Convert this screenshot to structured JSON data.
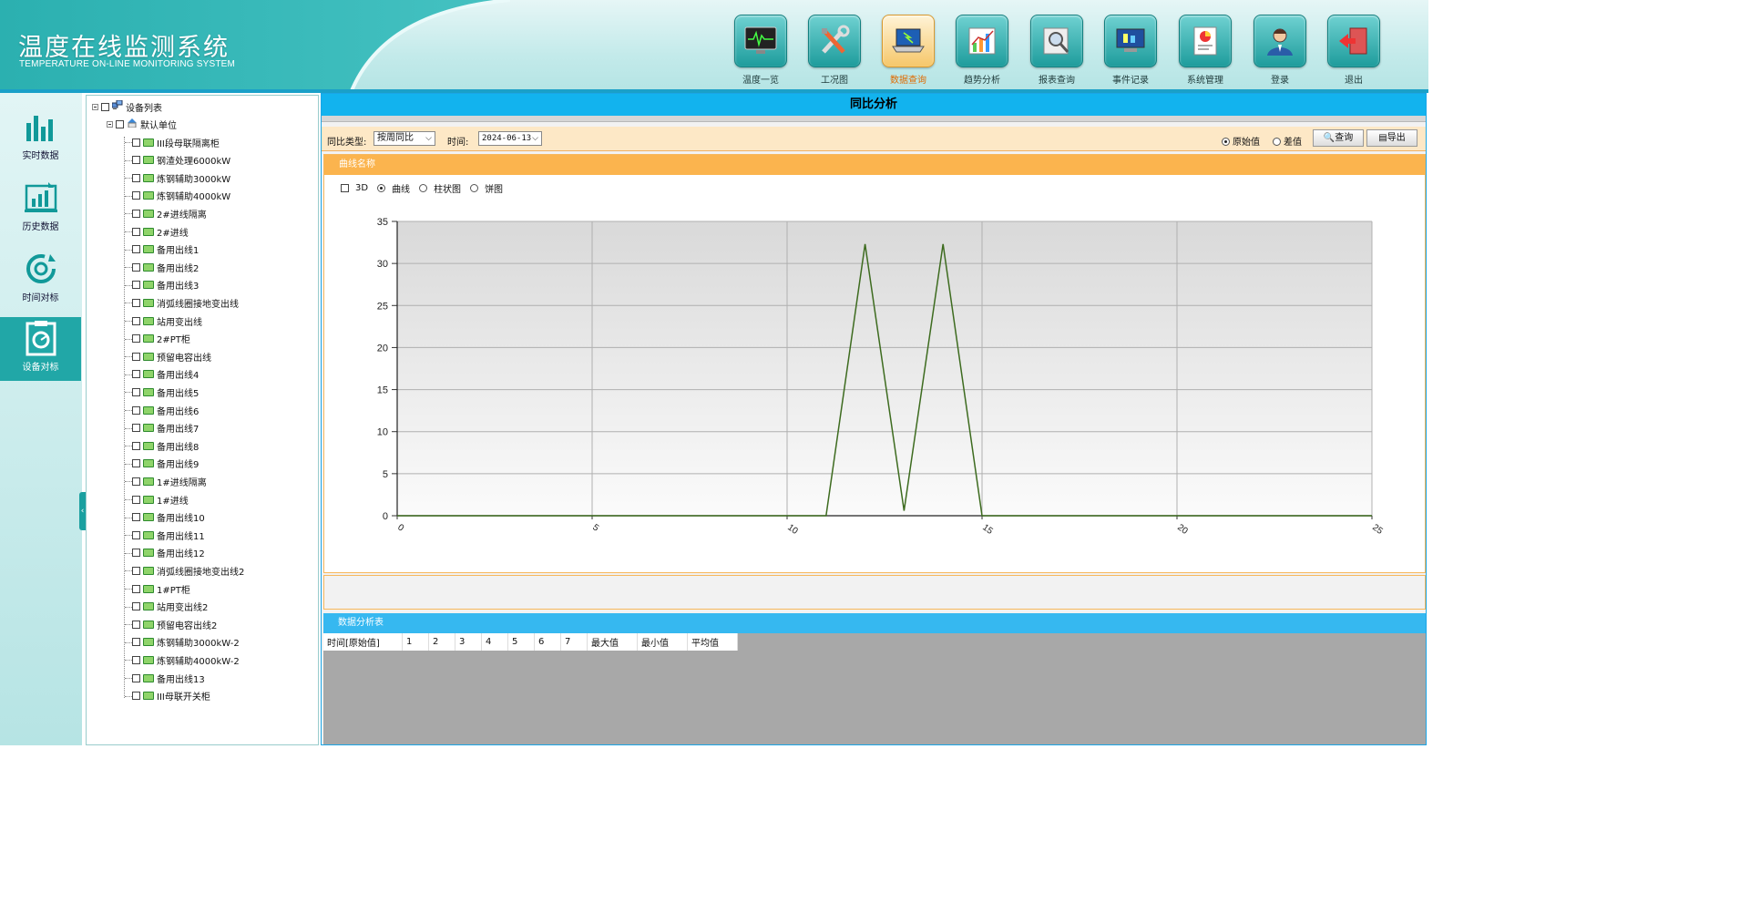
{
  "app": {
    "title": "温度在线监测系统",
    "subtitle": "TEMPERATURE ON-LINE MONITORING SYSTEM"
  },
  "nav": [
    {
      "label": "温度一览",
      "icon": "monitor-waveform-icon",
      "active": false
    },
    {
      "label": "工况图",
      "icon": "tools-icon",
      "active": false
    },
    {
      "label": "数据查询",
      "icon": "laptop-icon",
      "active": true
    },
    {
      "label": "趋势分析",
      "icon": "trend-chart-icon",
      "active": false
    },
    {
      "label": "报表查询",
      "icon": "magnifier-icon",
      "active": false
    },
    {
      "label": "事件记录",
      "icon": "event-screen-icon",
      "active": false
    },
    {
      "label": "系统管理",
      "icon": "document-chart-icon",
      "active": false
    },
    {
      "label": "登录",
      "icon": "user-icon",
      "active": false
    },
    {
      "label": "退出",
      "icon": "exit-door-icon",
      "active": false
    }
  ],
  "sidebar": [
    {
      "label": "实时数据",
      "icon": "bar-chart-icon",
      "active": false
    },
    {
      "label": "历史数据",
      "icon": "history-chart-icon",
      "active": false
    },
    {
      "label": "时间对标",
      "icon": "refresh-cycle-icon",
      "active": false
    },
    {
      "label": "设备对标",
      "icon": "clipboard-gauge-icon",
      "active": true
    }
  ],
  "tree": {
    "root": "设备列表",
    "unit": "默认单位",
    "items": [
      "III段母联隔离柜",
      "钢渣处理6000kW",
      "炼钢辅助3000kW",
      "炼钢辅助4000kW",
      "2#进线隔离",
      "2#进线",
      "备用出线1",
      "备用出线2",
      "备用出线3",
      "消弧线圈接地变出线",
      "站用变出线",
      "2#PT柜",
      "预留电容出线",
      "备用出线4",
      "备用出线5",
      "备用出线6",
      "备用出线7",
      "备用出线8",
      "备用出线9",
      "1#进线隔离",
      "1#进线",
      "备用出线10",
      "备用出线11",
      "备用出线12",
      "消弧线圈接地变出线2",
      "1#PT柜",
      "站用变出线2",
      "预留电容出线2",
      "炼钢辅助3000kW-2",
      "炼钢辅助4000kW-2",
      "备用出线13",
      "III母联开关柜"
    ]
  },
  "main": {
    "title": "同比分析",
    "filter": {
      "type_label": "同比类型:",
      "type_value": "按周同比",
      "time_label": "时间:",
      "time_value": "2024-06-13",
      "radio_raw": "原始值",
      "radio_diff": "差值",
      "query_btn": "查询",
      "export_btn": "导出"
    },
    "chart_panel_title": "曲线名称",
    "chart_options": {
      "cb_3d": "3D",
      "radio_curve": "曲线",
      "radio_bar": "柱状图",
      "radio_pie": "饼图"
    },
    "table_panel_title": "数据分析表",
    "table_headers": [
      "时间[原始值]",
      "1",
      "2",
      "3",
      "4",
      "5",
      "6",
      "7",
      "最大值",
      "最小值",
      "平均值"
    ]
  },
  "chart_data": {
    "type": "line",
    "title": "",
    "xlabel": "",
    "ylabel": "",
    "xlim": [
      0,
      25
    ],
    "ylim": [
      0,
      35
    ],
    "x_ticks": [
      "0",
      "5",
      "10",
      "15",
      "20",
      "25"
    ],
    "y_ticks": [
      "0",
      "5",
      "10",
      "15",
      "20",
      "25",
      "30",
      "35"
    ],
    "grid": true,
    "color": "#3d6b1f",
    "series": [
      {
        "x": [
          0,
          11,
          12,
          13,
          14,
          15,
          25
        ],
        "y": [
          0,
          0,
          32.3,
          0.6,
          32.3,
          0,
          0
        ]
      }
    ]
  }
}
